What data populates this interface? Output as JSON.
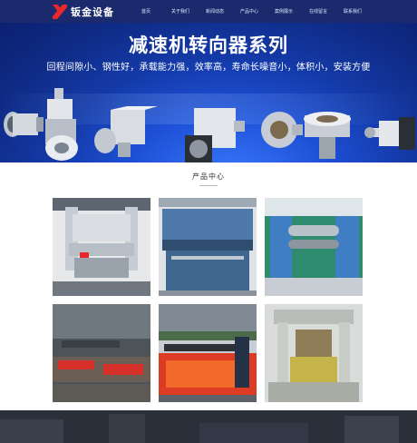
{
  "brand": {
    "name": "钣金设备",
    "accent": "#e8282a"
  },
  "nav": {
    "items": [
      {
        "label": "首页"
      },
      {
        "label": "关于我们"
      },
      {
        "label": "新闻动态"
      },
      {
        "label": "产品中心"
      },
      {
        "label": "案例展示"
      },
      {
        "label": "在线留言"
      },
      {
        "label": "联系我们"
      }
    ]
  },
  "banner": {
    "title": "减速机转向器系列",
    "subtitle": "回程间隙小、钢性好，承载能力强，效率高，寿命长噪音小，体积小，安装方便"
  },
  "products_section": {
    "title": "产品中心",
    "items": [
      {
        "image": "press-brake-machine"
      },
      {
        "image": "shearing-machine"
      },
      {
        "image": "plate-rolling-machine"
      },
      {
        "image": "cnc-cutting-table"
      },
      {
        "image": "plasma-cutting-machine"
      },
      {
        "image": "hydraulic-press"
      }
    ]
  },
  "colors": {
    "nav_bg": "#1a2a6c",
    "banner_blue": "#143aa8",
    "footer_dark": "#2a2f3a"
  }
}
